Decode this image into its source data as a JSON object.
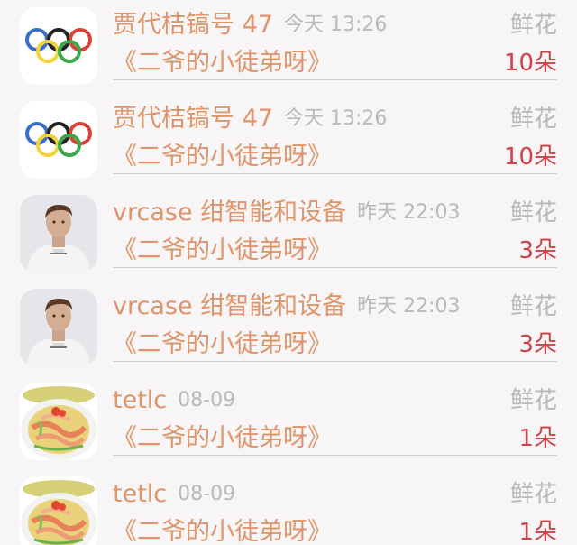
{
  "rows": [
    {
      "avatar": "olympic-rings-avatar",
      "name": "贾代桔镐号 47",
      "time": "今天 13:26",
      "gift_type": "鲜花",
      "book": "《二爷的小徒弟呀》",
      "gift_count": "10朵"
    },
    {
      "avatar": "olympic-rings-avatar",
      "name": "贾代桔镐号 47",
      "time": "今天 13:26",
      "gift_type": "鲜花",
      "book": "《二爷的小徒弟呀》",
      "gift_count": "10朵"
    },
    {
      "avatar": "man-portrait-avatar",
      "name": "vrcase 绀智能和设备",
      "time": "昨天 22:03",
      "gift_type": "鲜花",
      "book": "《二爷的小徒弟呀》",
      "gift_count": "3朵"
    },
    {
      "avatar": "man-portrait-avatar",
      "name": "vrcase 绀智能和设备",
      "time": "昨天 22:03",
      "gift_type": "鲜花",
      "book": "《二爷的小徒弟呀》",
      "gift_count": "3朵"
    },
    {
      "avatar": "noodle-dish-avatar",
      "name": "tetlc",
      "time": "08-09",
      "gift_type": "鲜花",
      "book": "《二爷的小徒弟呀》",
      "gift_count": "1朵"
    },
    {
      "avatar": "noodle-dish-avatar",
      "name": "tetlc",
      "time": "08-09",
      "gift_type": "鲜花",
      "book": "《二爷的小徒弟呀》",
      "gift_count": "1朵"
    }
  ],
  "colors": {
    "name": "#e0946a",
    "meta": "#b9b9b9",
    "count": "#d24048",
    "background": "#f7f5f6"
  }
}
